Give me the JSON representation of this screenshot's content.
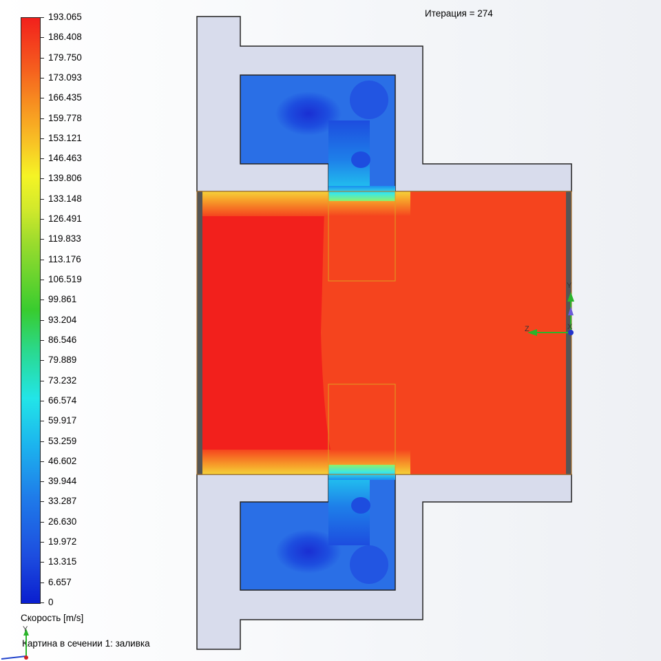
{
  "iteration_label": "Итерация = 274",
  "legend": {
    "values": [
      "193.065",
      "186.408",
      "179.750",
      "173.093",
      "166.435",
      "159.778",
      "153.121",
      "146.463",
      "139.806",
      "133.148",
      "126.491",
      "119.833",
      "113.176",
      "106.519",
      "99.861",
      "93.204",
      "86.546",
      "79.889",
      "73.232",
      "66.574",
      "59.917",
      "53.259",
      "46.602",
      "39.944",
      "33.287",
      "26.630",
      "19.972",
      "13.315",
      "6.657",
      "0"
    ],
    "title": "Скорость [m/s]",
    "max": 193.065,
    "min": 0
  },
  "cut_plot_label": "Картина в сечении 1: заливка",
  "axes": {
    "main": {
      "y": "Y",
      "x": "X",
      "z": "Z"
    },
    "small": {
      "y": "Y"
    }
  },
  "colors": {
    "solid": "#d8dcec",
    "max_red": "#f2201c",
    "high_orange": "#f5441e",
    "low_blue": "#1d4ddf"
  }
}
